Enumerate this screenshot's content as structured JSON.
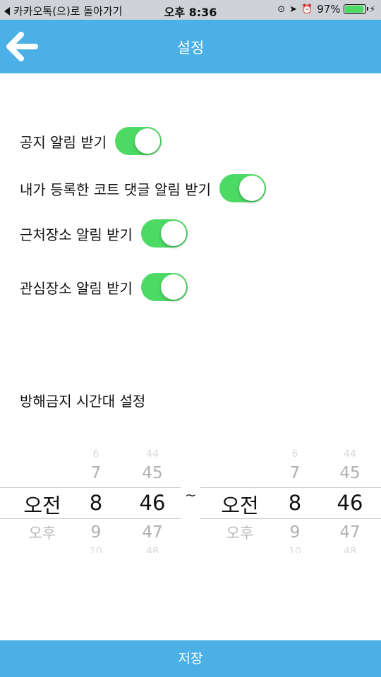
{
  "status_bar": {
    "back_app": "카카오톡(으)로 돌아가기",
    "time": "오후 8:36",
    "battery_text": "97%",
    "battery_level": 0.97
  },
  "header": {
    "title": "설정"
  },
  "settings": [
    {
      "label": "공지 알림 받기",
      "enabled": true
    },
    {
      "label": "내가 등록한 코트 댓글 알림 받기",
      "enabled": true
    },
    {
      "label": "근처장소 알림 받기",
      "enabled": true
    },
    {
      "label": "관심장소 알림 받기",
      "enabled": true
    }
  ],
  "dnd": {
    "title": "방해금지 시간대 설정",
    "separator": "~",
    "start": {
      "ampm": [
        "오전",
        "오후"
      ],
      "hours": [
        "7",
        "8",
        "9"
      ],
      "minutes": [
        "45",
        "46",
        "47"
      ],
      "selected_ampm": "오전",
      "selected_hour": "8",
      "selected_minute": "46"
    },
    "end": {
      "ampm": [
        "오전",
        "오후"
      ],
      "hours": [
        "7",
        "8",
        "9"
      ],
      "minutes": [
        "45",
        "46",
        "47"
      ],
      "selected_ampm": "오전",
      "selected_hour": "8",
      "selected_minute": "46"
    }
  },
  "save_label": "저장",
  "colors": {
    "accent": "#4ab0e5",
    "toggle_on": "#4cd964",
    "status_bg": "#cfd3d8"
  }
}
